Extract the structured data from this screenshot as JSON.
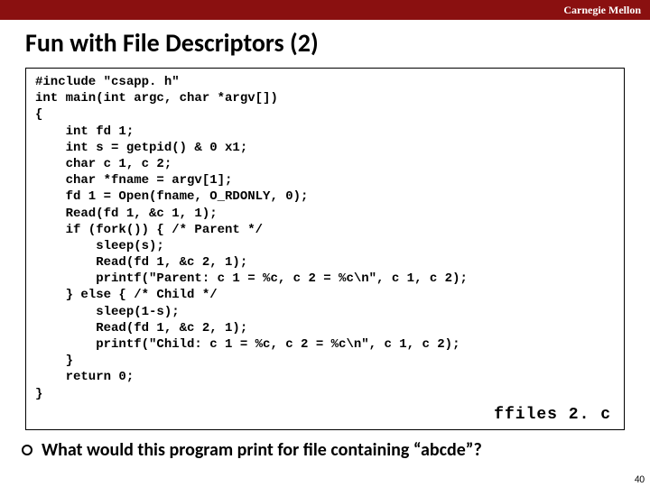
{
  "header": {
    "brand": "Carnegie Mellon"
  },
  "title": "Fun with File Descriptors (2)",
  "code": "#include \"csapp. h\"\nint main(int argc, char *argv[])\n{\n    int fd 1;\n    int s = getpid() & 0 x1;\n    char c 1, c 2;\n    char *fname = argv[1];\n    fd 1 = Open(fname, O_RDONLY, 0);\n    Read(fd 1, &c 1, 1);\n    if (fork()) { /* Parent */\n        sleep(s);\n        Read(fd 1, &c 2, 1);\n        printf(\"Parent: c 1 = %c, c 2 = %c\\n\", c 1, c 2);\n    } else { /* Child */\n        sleep(1-s);\n        Read(fd 1, &c 2, 1);\n        printf(\"Child: c 1 = %c, c 2 = %c\\n\", c 1, c 2);\n    }\n    return 0;\n}",
  "filename": "ffiles 2. c",
  "question": "What would this program print for file containing “abcde”?",
  "page": "40"
}
